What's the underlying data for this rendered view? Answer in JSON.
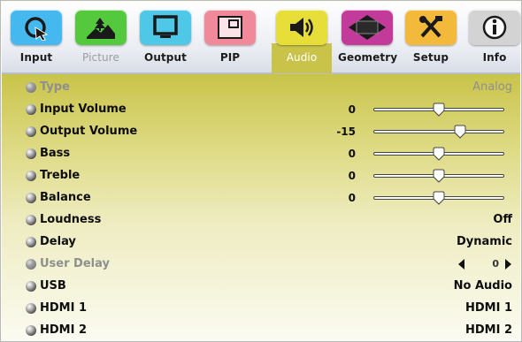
{
  "tabs": [
    {
      "label": "Input",
      "icon": "input-cursor-icon",
      "color": "#46b8f0",
      "state": "normal"
    },
    {
      "label": "Picture",
      "icon": "picture-landscape-icon",
      "color": "#55c93e",
      "state": "dim"
    },
    {
      "label": "Output",
      "icon": "output-monitor-icon",
      "color": "#4fc7e6",
      "state": "normal"
    },
    {
      "label": "PIP",
      "icon": "pip-window-icon",
      "color": "#f08a9a",
      "state": "normal"
    },
    {
      "label": "Audio",
      "icon": "audio-speaker-icon",
      "color": "#e7de39",
      "state": "active"
    },
    {
      "label": "Geometry",
      "icon": "geometry-diamond-icon",
      "color": "#c23a9a",
      "state": "normal"
    },
    {
      "label": "Setup",
      "icon": "setup-tools-icon",
      "color": "#f3b93a",
      "state": "normal"
    },
    {
      "label": "Info",
      "icon": "info-circle-icon",
      "color": "#d3d3d3",
      "state": "normal"
    }
  ],
  "audio_menu": {
    "items": [
      {
        "label": "Type",
        "value": "Analog",
        "kind": "text",
        "state": "dim"
      },
      {
        "label": "Input Volume",
        "value": "0",
        "kind": "slider",
        "level": 0.5
      },
      {
        "label": "Output Volume",
        "value": "-15",
        "kind": "slider",
        "level": 0.66
      },
      {
        "label": "Bass",
        "value": "0",
        "kind": "slider",
        "level": 0.5
      },
      {
        "label": "Treble",
        "value": "0",
        "kind": "slider",
        "level": 0.5
      },
      {
        "label": "Balance",
        "value": "0",
        "kind": "slider",
        "level": 0.5
      },
      {
        "label": "Loudness",
        "value": "Off",
        "kind": "text"
      },
      {
        "label": "Delay",
        "value": "Dynamic",
        "kind": "text"
      },
      {
        "label": "User Delay",
        "value": "0",
        "kind": "stepper",
        "state": "dim"
      },
      {
        "label": "USB",
        "value": "No Audio",
        "kind": "text"
      },
      {
        "label": "HDMI 1",
        "value": "HDMI 1",
        "kind": "text"
      },
      {
        "label": "HDMI 2",
        "value": "HDMI 2",
        "kind": "text"
      }
    ]
  },
  "colors": {
    "menu_accent": "#c9c449",
    "active_tab_text": "#ffffff",
    "dim_text": "#8f8f8f"
  }
}
